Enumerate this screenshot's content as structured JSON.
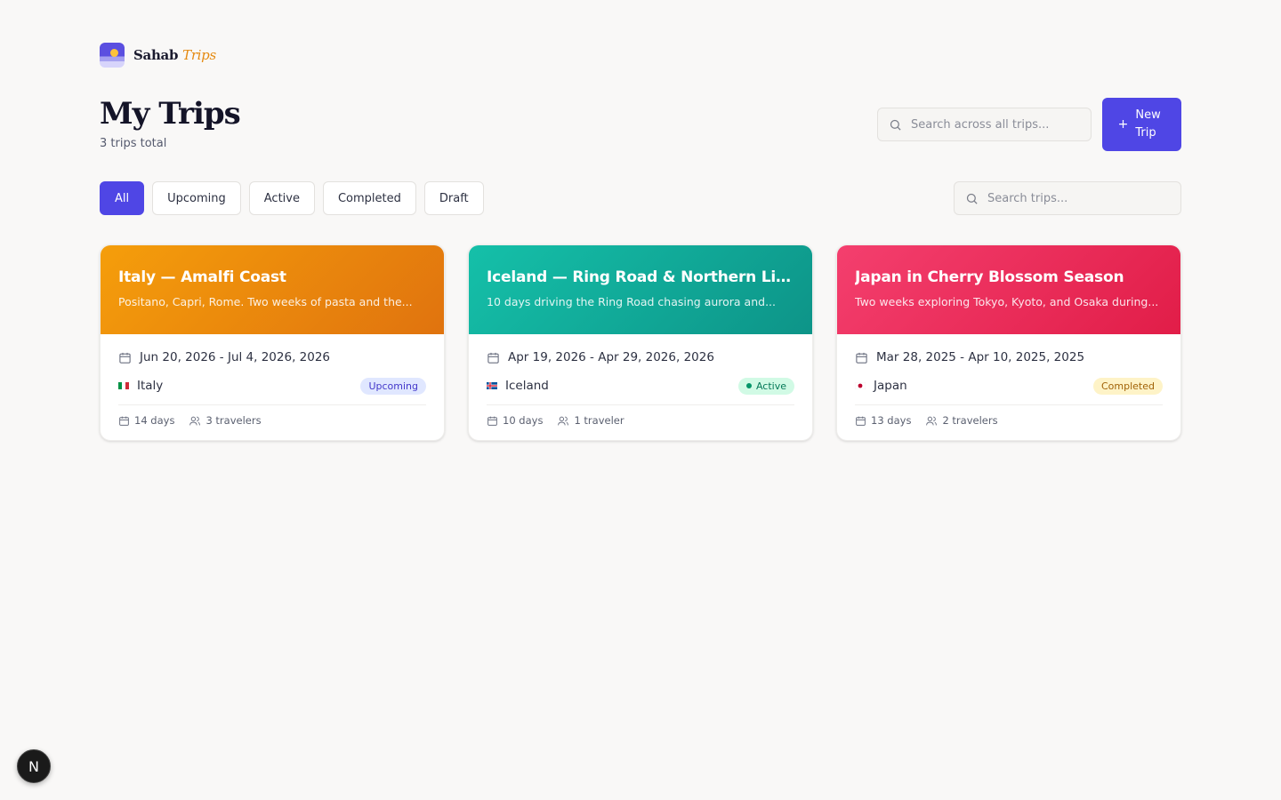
{
  "brand": {
    "name": "Sahab",
    "accent": "Trips"
  },
  "header": {
    "title": "My Trips",
    "subtitle": "3 trips total",
    "global_search_placeholder": "Search across all trips...",
    "new_trip_label": "New Trip",
    "new_trip_icon": "plus-icon"
  },
  "filters": {
    "tabs": [
      "All",
      "Upcoming",
      "Active",
      "Completed",
      "Draft"
    ],
    "selected": "All",
    "search_placeholder": "Search trips..."
  },
  "trips": [
    {
      "title": "Italy — Amalfi Coast",
      "description": "Positano, Capri, Rome. Two weeks of pasta and the...",
      "dates": "Jun 20, 2026 - Jul 4, 2026, 2026",
      "country": "Italy",
      "status": "Upcoming",
      "duration": "14 days",
      "travelers": "3 travelers",
      "color": "#f59e0b"
    },
    {
      "title": "Iceland — Ring Road & Northern Lights",
      "description": "10 days driving the Ring Road chasing aurora and...",
      "dates": "Apr 19, 2026 - Apr 29, 2026, 2026",
      "country": "Iceland",
      "status": "Active",
      "duration": "10 days",
      "travelers": "1 traveler",
      "color": "#14b8a6"
    },
    {
      "title": "Japan in Cherry Blossom Season",
      "description": "Two weeks exploring Tokyo, Kyoto, and Osaka during...",
      "dates": "Mar 28, 2025 - Apr 10, 2025, 2025",
      "country": "Japan",
      "status": "Completed",
      "duration": "13 days",
      "travelers": "2 travelers",
      "color": "#f43f5e"
    }
  ],
  "dev_badge": "N",
  "colors": {
    "primary": "#4f46e5",
    "background": "#f9f8f7"
  }
}
